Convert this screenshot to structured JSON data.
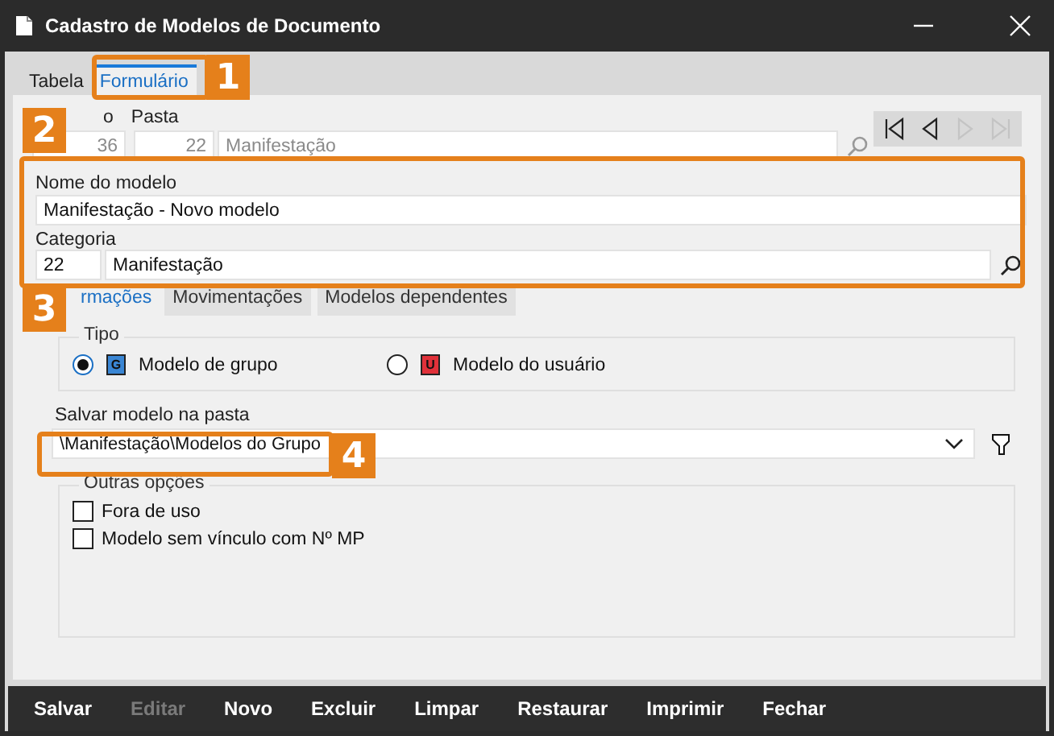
{
  "window": {
    "title": "Cadastro de Modelos de Documento"
  },
  "tabs": [
    {
      "label": "Tabela",
      "selected": false
    },
    {
      "label": "Formulário",
      "selected": true
    }
  ],
  "record": {
    "code_label": "o",
    "code": "36",
    "folder_label": "Pasta",
    "folder_number": "22",
    "folder_name": "Manifestação"
  },
  "navigation": [
    {
      "kind": "first",
      "disabled": false
    },
    {
      "kind": "previous",
      "disabled": false
    },
    {
      "kind": "next",
      "disabled": true
    },
    {
      "kind": "last",
      "disabled": true
    }
  ],
  "model_name": {
    "label": "Nome do modelo",
    "value": "Manifestação - Novo modelo"
  },
  "category": {
    "label": "Categoria",
    "number": "22",
    "name": "Manifestação"
  },
  "subtabs": [
    {
      "label": "rmações",
      "selected": true
    },
    {
      "label": "Movimentações",
      "selected": false
    },
    {
      "label": "Modelos dependentes",
      "selected": false
    }
  ],
  "type_group": {
    "legend": "Tipo",
    "options": [
      {
        "badge": "G",
        "label": "Modelo de grupo",
        "selected": true,
        "color": "#3a86d4"
      },
      {
        "badge": "U",
        "label": "Modelo do usuário",
        "selected": false,
        "color": "#e0313a"
      }
    ]
  },
  "save_folder": {
    "label": "Salvar modelo na pasta",
    "value": "\\Manifestação\\Modelos do Grupo"
  },
  "other_options": {
    "legend": "Outras opções",
    "items": [
      {
        "label": "Fora de uso",
        "checked": false
      },
      {
        "label": "Modelo sem vínculo com Nº MP",
        "checked": false
      }
    ]
  },
  "actions": [
    {
      "label": "Salvar",
      "disabled": false
    },
    {
      "label": "Editar",
      "disabled": true
    },
    {
      "label": "Novo",
      "disabled": false
    },
    {
      "label": "Excluir",
      "disabled": false
    },
    {
      "label": "Limpar",
      "disabled": false
    },
    {
      "label": "Restaurar",
      "disabled": false
    },
    {
      "label": "Imprimir",
      "disabled": false
    },
    {
      "label": "Fechar",
      "disabled": false
    }
  ],
  "callouts": [
    "1",
    "2",
    "3",
    "4"
  ]
}
